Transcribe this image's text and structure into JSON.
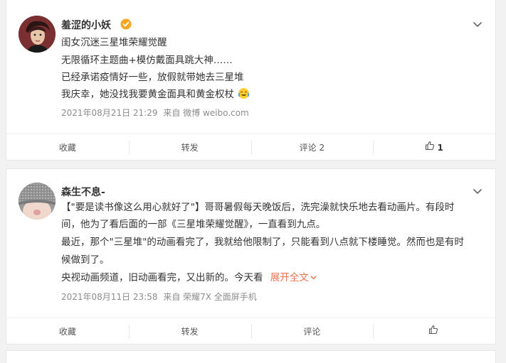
{
  "posts": [
    {
      "username": "羞涩的小妖",
      "lines": [
        "闺女沉迷三星堆荣耀觉醒",
        "无限循环主题曲+模仿戴面具跳大神……",
        "已经承诺疫情好一些，放假就带她去三星堆",
        "我庆幸，她没找我要黄金面具和黄金权杖"
      ],
      "emoji": "laugh-cry-emoji",
      "timestamp": "2021年08月21日 21:29",
      "source": "来自 微博 weibo.com",
      "actions": {
        "favorite": "收藏",
        "repost": "转发",
        "comment": "评论 2",
        "like_count": "1"
      }
    },
    {
      "username": "森生不息-",
      "lines": [
        "【\"要是读书像这么用心就好了\"】哥哥暑假每天晚饭后，洗完澡就快乐地去看动画片。有段时",
        "间，他为了看后面的一部《三星堆荣耀觉醒》，一直看到九点。",
        "最近，那个\"三星堆\"的动画看完了，我就给他限制了，只能看到八点就下楼睡觉。然而也是有时",
        "候做到了。",
        "央视动画频道，旧动画看完，又出新的。今天看"
      ],
      "expand_label": "展开全文",
      "timestamp": "2021年08月11日 23:58",
      "source": "来自 荣耀7X 全面屏手机",
      "actions": {
        "favorite": "收藏",
        "repost": "转发",
        "comment": "评论",
        "like_count": ""
      }
    }
  ],
  "colors": {
    "accent": "#eb7350",
    "verified": "#f6a623",
    "meta": "#8c8c8c"
  }
}
